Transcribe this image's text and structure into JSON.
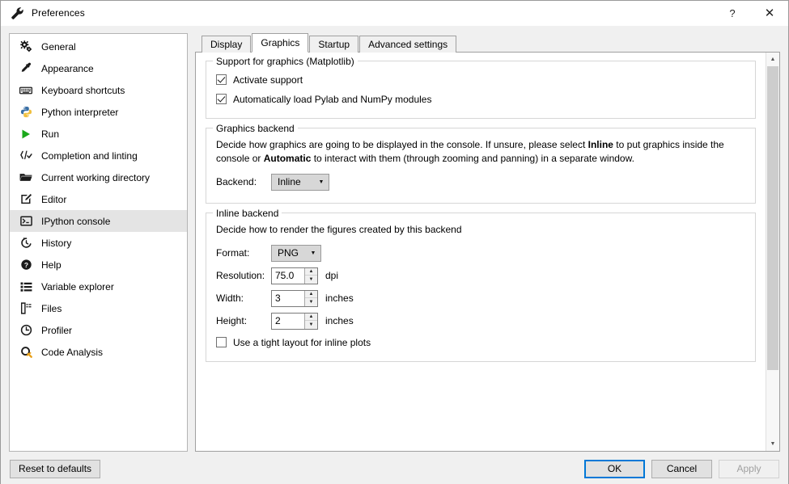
{
  "window": {
    "title": "Preferences",
    "icon": "wrench-icon",
    "help_label": "?",
    "close_label": "✕"
  },
  "sidebar": {
    "items": [
      {
        "label": "General",
        "icon": "gears-icon",
        "selected": false
      },
      {
        "label": "Appearance",
        "icon": "eyedropper-icon",
        "selected": false
      },
      {
        "label": "Keyboard shortcuts",
        "icon": "keyboard-icon",
        "selected": false
      },
      {
        "label": "Python interpreter",
        "icon": "python-icon",
        "selected": false
      },
      {
        "label": "Run",
        "icon": "play-icon",
        "selected": false
      },
      {
        "label": "Completion and linting",
        "icon": "completion-icon",
        "selected": false
      },
      {
        "label": "Current working directory",
        "icon": "folder-icon",
        "selected": false
      },
      {
        "label": "Editor",
        "icon": "pencil-square-icon",
        "selected": false
      },
      {
        "label": "IPython console",
        "icon": "console-icon",
        "selected": true
      },
      {
        "label": "History",
        "icon": "history-clock-icon",
        "selected": false
      },
      {
        "label": "Help",
        "icon": "question-circle-icon",
        "selected": false
      },
      {
        "label": "Variable explorer",
        "icon": "list-icon",
        "selected": false
      },
      {
        "label": "Files",
        "icon": "files-icon",
        "selected": false
      },
      {
        "label": "Profiler",
        "icon": "clock-icon",
        "selected": false
      },
      {
        "label": "Code Analysis",
        "icon": "code-analysis-icon",
        "selected": false
      }
    ]
  },
  "tabs": [
    {
      "label": "Display",
      "active": false
    },
    {
      "label": "Graphics",
      "active": true
    },
    {
      "label": "Startup",
      "active": false
    },
    {
      "label": "Advanced settings",
      "active": false
    }
  ],
  "graphics": {
    "support_group": {
      "title": "Support for graphics (Matplotlib)",
      "checkboxes": [
        {
          "label": "Activate support",
          "checked": true
        },
        {
          "label": "Automatically load Pylab and NumPy modules",
          "checked": true
        }
      ]
    },
    "backend_group": {
      "title": "Graphics backend",
      "description_part1": "Decide how graphics are going to be displayed in the console. If unsure, please select ",
      "description_bold1": "Inline",
      "description_part2": " to put graphics inside the console or ",
      "description_bold2": "Automatic",
      "description_part3": " to interact with them (through zooming and panning) in a separate window.",
      "backend_label": "Backend:",
      "backend_value": "Inline"
    },
    "inline_group": {
      "title": "Inline backend",
      "description": "Decide how to render the figures created by this backend",
      "format_label": "Format:",
      "format_value": "PNG",
      "resolution_label": "Resolution:",
      "resolution_value": "75.0",
      "resolution_unit": "dpi",
      "width_label": "Width:",
      "width_value": "3",
      "width_unit": "inches",
      "height_label": "Height:",
      "height_value": "2",
      "height_unit": "inches",
      "tight_layout": {
        "label": "Use a tight layout for inline plots",
        "checked": false
      }
    }
  },
  "footer": {
    "reset_label": "Reset to defaults",
    "ok_label": "OK",
    "cancel_label": "Cancel",
    "apply_label": "Apply"
  },
  "colors": {
    "accent": "#0078d7",
    "window_bg": "#f0f0f0",
    "panel_bg": "#ffffff",
    "selected_row": "#e4e4e4"
  }
}
